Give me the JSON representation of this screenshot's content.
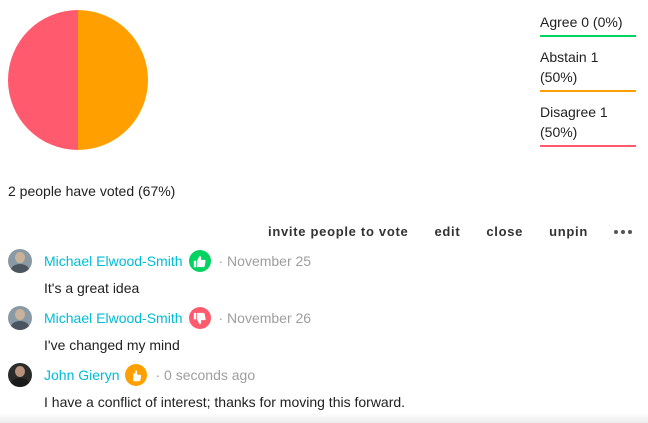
{
  "chart_data": {
    "type": "pie",
    "categories": [
      "Agree",
      "Abstain",
      "Disagree"
    ],
    "values": [
      0,
      1,
      1
    ],
    "colors": [
      "#00d35f",
      "#ffa000",
      "#ff5a6e"
    ]
  },
  "legend": {
    "agree": "Agree 0 (0%)",
    "abstain": "Abstain 1 (50%)",
    "disagree": "Disagree 1 (50%)"
  },
  "summary": "2 people have voted (67%)",
  "actions": {
    "invite": "invite people to vote",
    "edit": "edit",
    "close": "close",
    "unpin": "unpin",
    "more_icon": "more-horizontal-icon"
  },
  "comments": [
    {
      "author": "Michael Elwood-Smith",
      "badge": "thumbs-up-icon",
      "date": "· November 25",
      "text": "It's a great idea"
    },
    {
      "author": "Michael Elwood-Smith",
      "badge": "thumbs-down-icon",
      "date": "· November 26",
      "text": "I've changed my mind"
    },
    {
      "author": "John Gieryn",
      "badge": "hand-icon",
      "date": "· 0 seconds ago",
      "text": "I have a conflict of interest; thanks for moving this forward."
    }
  ]
}
